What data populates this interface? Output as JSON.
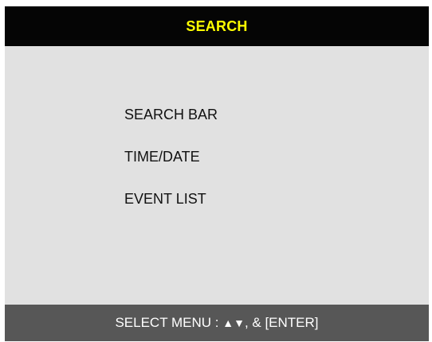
{
  "header": {
    "title": "SEARCH"
  },
  "menu": {
    "items": [
      {
        "label": "SEARCH BAR"
      },
      {
        "label": "TIME/DATE"
      },
      {
        "label": "EVENT LIST"
      }
    ]
  },
  "footer": {
    "hint_prefix": "SELECT MENU : ",
    "hint_arrows": "▲▼",
    "hint_suffix": ", & [ENTER]"
  },
  "colors": {
    "header_bg": "#050505",
    "header_text": "#ffff00",
    "panel_bg": "#e1e1e1",
    "footer_bg": "#575757",
    "footer_text": "#ffffff"
  }
}
